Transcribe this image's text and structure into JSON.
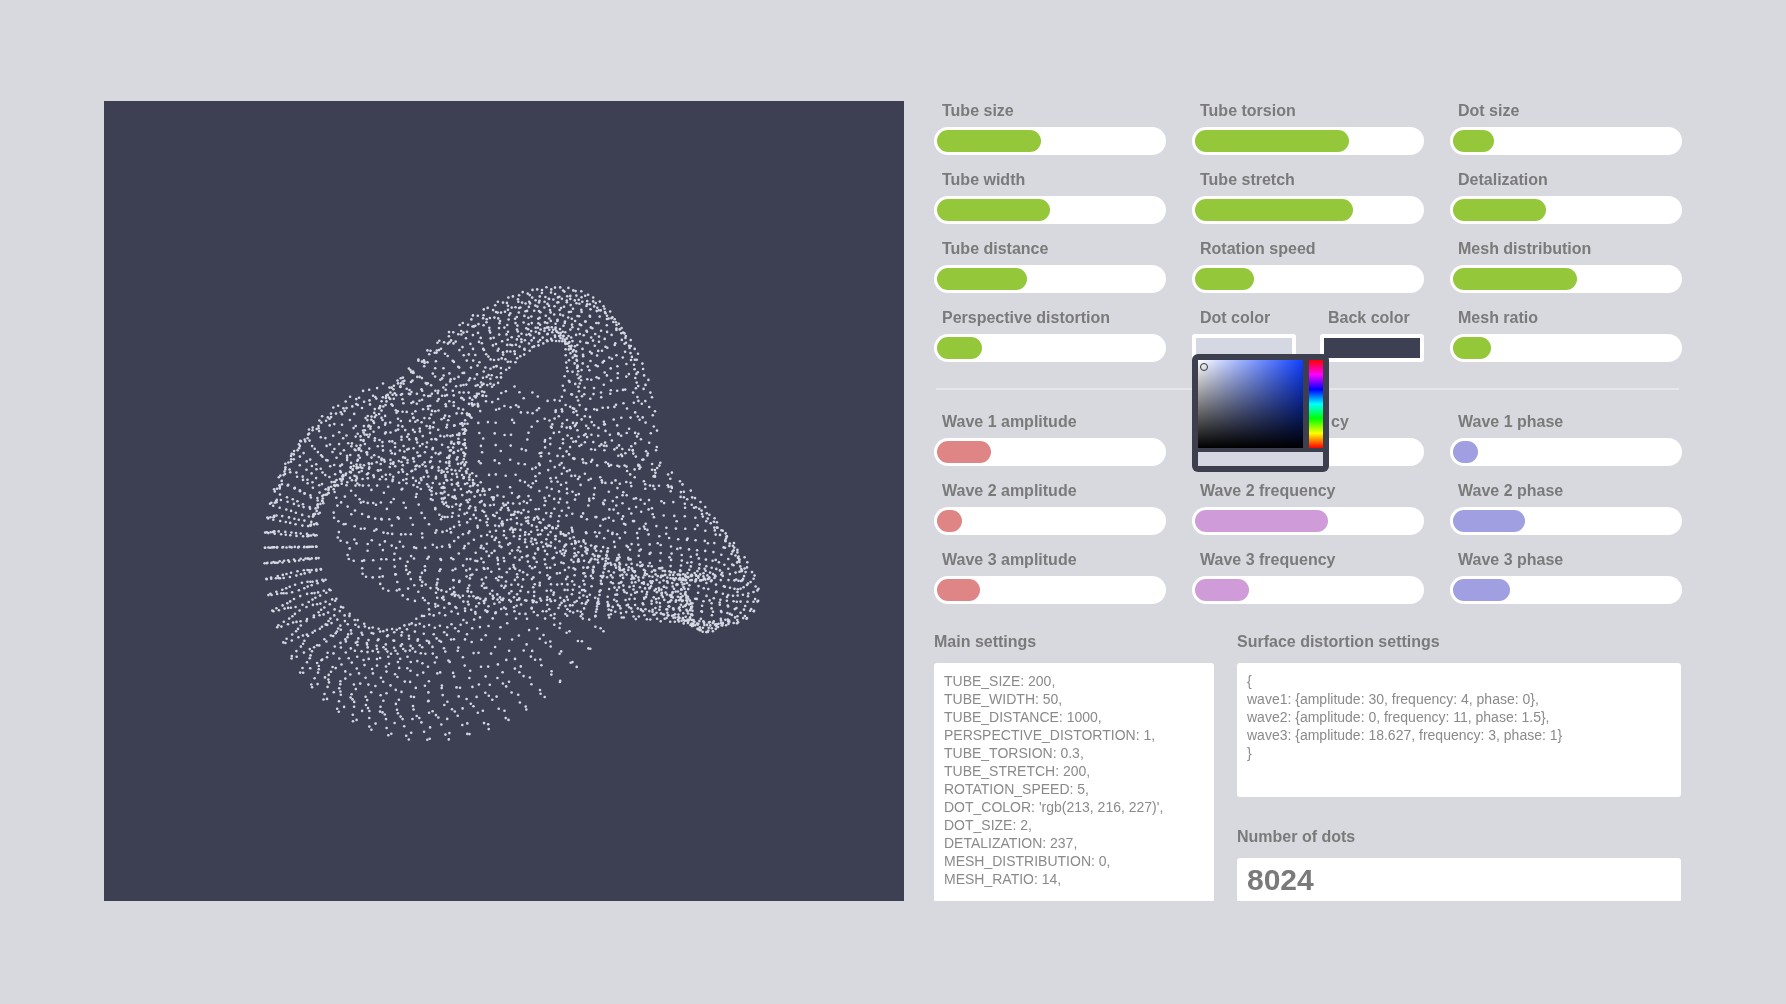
{
  "controls": [
    {
      "kind": "slider",
      "label": "Tube size",
      "level": 0.46,
      "color": "#94c83a"
    },
    {
      "kind": "slider",
      "label": "Tube torsion",
      "level": 0.68,
      "color": "#94c83a"
    },
    {
      "kind": "slider",
      "label": "Dot size",
      "level": 0.18,
      "color": "#94c83a"
    },
    {
      "kind": "slider",
      "label": "Tube width",
      "level": 0.5,
      "color": "#94c83a"
    },
    {
      "kind": "slider",
      "label": "Tube stretch",
      "level": 0.7,
      "color": "#94c83a"
    },
    {
      "kind": "slider",
      "label": "Detalization",
      "level": 0.41,
      "color": "#94c83a"
    },
    {
      "kind": "slider",
      "label": "Tube distance",
      "level": 0.4,
      "color": "#94c83a"
    },
    {
      "kind": "slider",
      "label": "Rotation speed",
      "level": 0.26,
      "color": "#94c83a"
    },
    {
      "kind": "slider",
      "label": "Mesh distribution",
      "level": 0.55,
      "color": "#94c83a"
    },
    {
      "kind": "slider",
      "label": "Perspective distortion",
      "level": 0.2,
      "color": "#94c83a"
    },
    {
      "kind": "colors",
      "items": [
        {
          "label": "Dot color",
          "color": "#d5d8e3",
          "picker_open": true
        },
        {
          "label": "Back color",
          "color": "#3d3f53"
        }
      ]
    },
    {
      "kind": "slider",
      "label": "Mesh ratio",
      "level": 0.17,
      "color": "#94c83a"
    }
  ],
  "waves": [
    {
      "kind": "slider",
      "label": "Wave 1 amplitude",
      "level": 0.24,
      "color": "#e08585"
    },
    {
      "kind": "slider",
      "label": "cy",
      "obscured": true
    },
    {
      "kind": "slider",
      "label": "Wave 1 phase",
      "level": 0.11,
      "color": "#a09fe2"
    },
    {
      "kind": "slider",
      "label": "Wave 2 amplitude",
      "level": 0.11,
      "color": "#e08585"
    },
    {
      "kind": "slider",
      "label": "Wave 2 frequency",
      "level": 0.59,
      "color": "#cf9bd8"
    },
    {
      "kind": "slider",
      "label": "Wave 2 phase",
      "level": 0.32,
      "color": "#a09fe2"
    },
    {
      "kind": "slider",
      "label": "Wave 3 amplitude",
      "level": 0.19,
      "color": "#e08585"
    },
    {
      "kind": "slider",
      "label": "Wave 3 frequency",
      "level": 0.24,
      "color": "#cf9bd8"
    },
    {
      "kind": "slider",
      "label": "Wave 3 phase",
      "level": 0.25,
      "color": "#a09fe2"
    }
  ],
  "main_settings": {
    "title": "Main settings",
    "lines": [
      "TUBE_SIZE: 200,",
      "TUBE_WIDTH: 50,",
      "TUBE_DISTANCE: 1000,",
      "PERSPECTIVE_DISTORTION: 1,",
      "TUBE_TORSION: 0.3,",
      "TUBE_STRETCH: 200,",
      "ROTATION_SPEED: 5,",
      "DOT_COLOR: 'rgb(213, 216, 227)',",
      "DOT_SIZE: 2,",
      "DETALIZATION: 237,",
      "MESH_DISTRIBUTION: 0,",
      "MESH_RATIO: 14,"
    ]
  },
  "surface_settings": {
    "title": "Surface distortion settings",
    "lines": [
      "{",
      "wave1: {amplitude: 30, frequency: 4, phase: 0},",
      "wave2: {amplitude: 0, frequency: 11, phase: 1.5},",
      "wave3: {amplitude: 18.627, frequency: 3, phase: 1}",
      "}"
    ]
  },
  "dots": {
    "title": "Number of dots",
    "value": "8024"
  }
}
